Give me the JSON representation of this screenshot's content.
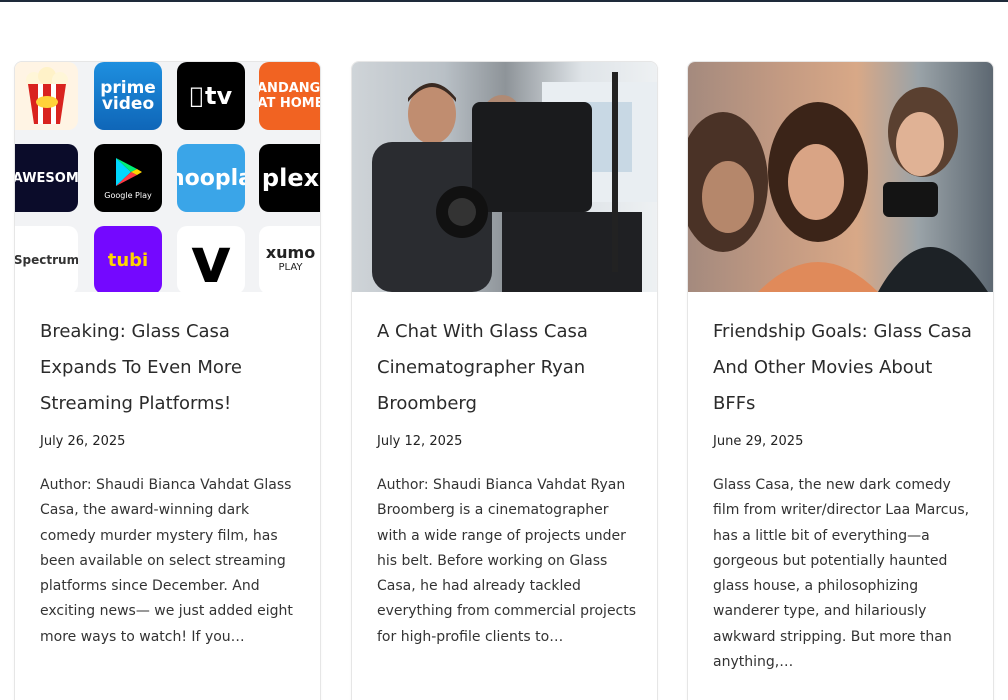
{
  "posts": [
    {
      "title": "Breaking: Glass Casa Expands To Even More Streaming Platforms!",
      "date": "July 26, 2025",
      "excerpt": "Author: Shaudi Bianca Vahdat Glass Casa, the award-winning dark comedy murder mystery film, has been available on select streaming platforms since December. And exciting news— we just added eight more ways to watch! If you…",
      "logos": {
        "prime": "prime video",
        "apple": "tv",
        "fandango": "FANDANGO AT HOME",
        "fawesome": "FAWESOME",
        "gplay": "Google Play",
        "hoopla": "hoopla",
        "plex": "plex",
        "spectrum": "Spectrum",
        "tubi": "tubi",
        "vimeo": "v",
        "xumo_top": "xumo",
        "xumo_bottom": "PLAY"
      }
    },
    {
      "title": "A Chat With Glass Casa Cinematographer Ryan Broomberg",
      "date": "July 12, 2025",
      "excerpt": "Author: Shaudi Bianca Vahdat Ryan Broomberg is a cinematographer with a wide range of projects under his belt. Before working on Glass Casa, he had already tackled everything from commercial projects for high-profile clients to…"
    },
    {
      "title": "Friendship Goals: Glass Casa And Other Movies About BFFs",
      "date": "June 29, 2025",
      "excerpt": "Glass Casa, the new dark comedy film from writer/director Laa Marcus, has a little bit of everything—a gorgeous but potentially haunted glass house, a philosophizing wanderer type, and hilariously awkward stripping.  But more than anything,…"
    }
  ]
}
